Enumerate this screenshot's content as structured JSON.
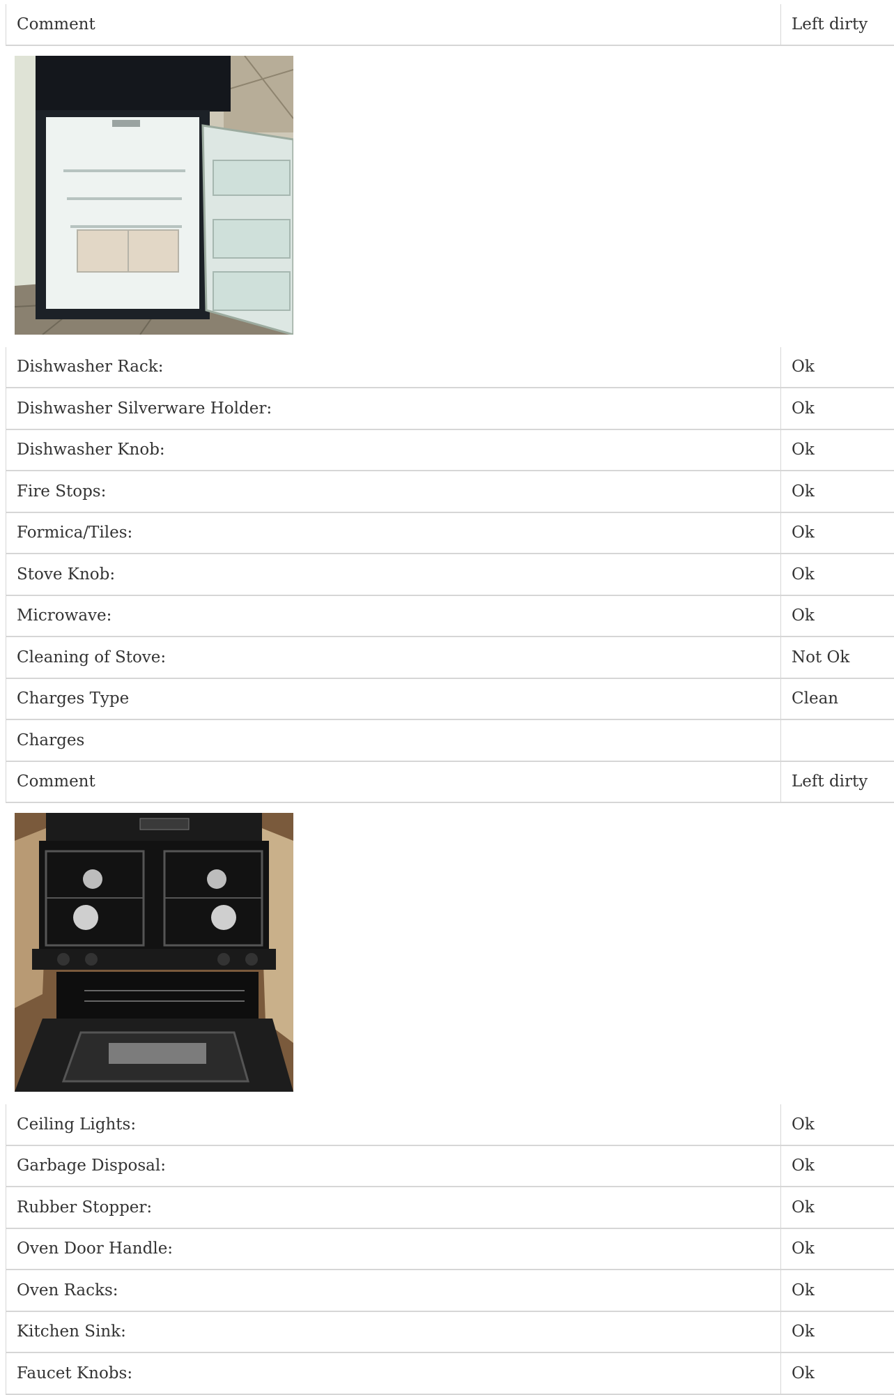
{
  "sections": [
    {
      "rows": [
        {
          "label": "Comment",
          "value": "Left dirty"
        }
      ],
      "photo": {
        "icon": "refrigerator-photo"
      }
    },
    {
      "rows": [
        {
          "label": "Dishwasher Rack:",
          "value": "Ok"
        },
        {
          "label": "Dishwasher Silverware Holder:",
          "value": "Ok"
        },
        {
          "label": "Dishwasher Knob:",
          "value": "Ok"
        },
        {
          "label": "Fire Stops:",
          "value": "Ok"
        },
        {
          "label": "Formica/Tiles:",
          "value": "Ok"
        },
        {
          "label": "Stove Knob:",
          "value": "Ok"
        },
        {
          "label": "Microwave:",
          "value": "Ok"
        },
        {
          "label": "Cleaning of Stove:",
          "value": "Not Ok"
        },
        {
          "label": "Charges Type",
          "value": "Clean"
        },
        {
          "label": "Charges",
          "value": ""
        },
        {
          "label": "Comment",
          "value": "Left dirty"
        }
      ],
      "photo": {
        "icon": "stove-photo"
      }
    },
    {
      "rows": [
        {
          "label": "Ceiling Lights:",
          "value": "Ok"
        },
        {
          "label": "Garbage Disposal:",
          "value": "Ok"
        },
        {
          "label": "Rubber Stopper:",
          "value": "Ok"
        },
        {
          "label": "Oven Door Handle:",
          "value": "Ok"
        },
        {
          "label": "Oven Racks:",
          "value": "Ok"
        },
        {
          "label": "Kitchen Sink:",
          "value": "Ok"
        },
        {
          "label": "Faucet Knobs:",
          "value": "Ok"
        }
      ]
    }
  ],
  "colors": {
    "border": "#d6d6d6",
    "text": "#333333",
    "background": "#ffffff"
  }
}
